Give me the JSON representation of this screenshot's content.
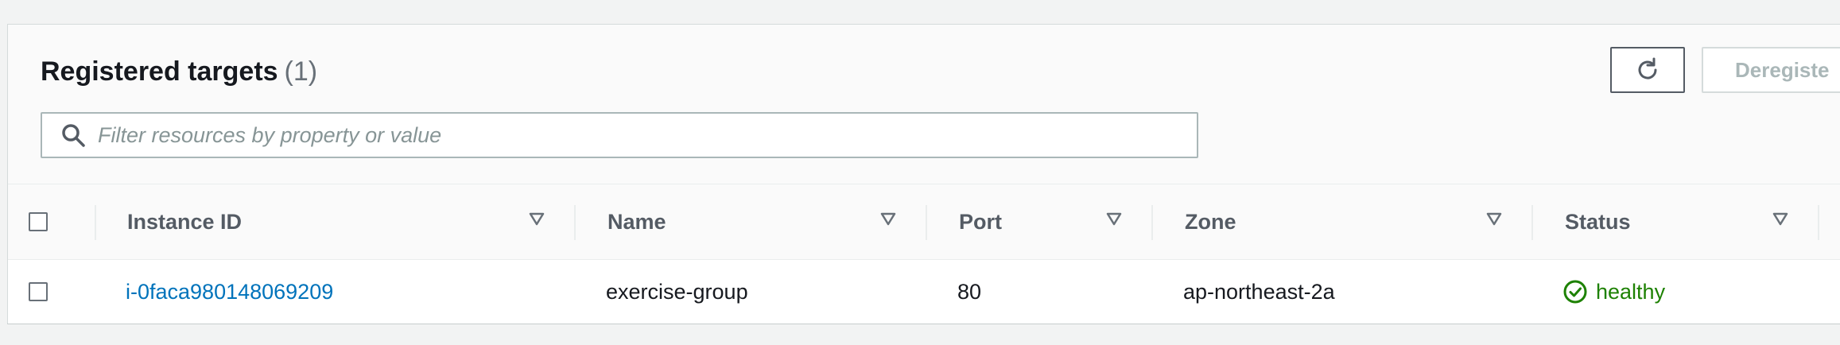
{
  "panel": {
    "title": "Registered targets",
    "count": "(1)",
    "refresh_icon": "refresh-icon",
    "deregister_label": "Deregiste"
  },
  "search": {
    "placeholder": "Filter resources by property or value",
    "value": "",
    "icon": "search-icon"
  },
  "table": {
    "columns": [
      "Instance ID",
      "Name",
      "Port",
      "Zone",
      "Status"
    ],
    "sort_icon": "sort-down-icon",
    "rows": [
      {
        "instance_id": "i-0faca980148069209",
        "name": "exercise-group",
        "port": "80",
        "zone": "ap-northeast-2a",
        "status": "healthy",
        "status_icon": "check-circle-icon"
      }
    ]
  },
  "colors": {
    "link": "#0073bb",
    "healthy": "#1d8102",
    "text": "#16191f",
    "header_text": "#545b64",
    "disabled": "#aab7b8"
  }
}
